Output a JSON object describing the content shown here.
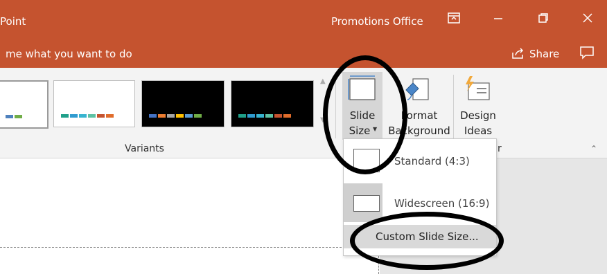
{
  "titlebar": {
    "app_fragment": "Point",
    "account": "Promotions Office",
    "icons": [
      "ribbon-display-icon",
      "minimize-icon",
      "restore-icon",
      "close-icon"
    ]
  },
  "tellbar": {
    "tell_me": "me what you want to do",
    "share": "Share"
  },
  "ribbon": {
    "variants_group_label": "Variants",
    "slide_size_line1": "Slide",
    "slide_size_line2": "Size",
    "format_background_line1": "Format",
    "format_background_line2": "Background",
    "design_ideas_line1": "Design",
    "design_ideas_line2": "Ideas",
    "designer_group_label_fragment": "r"
  },
  "dropdown": {
    "items": [
      {
        "label": "Standard (4:3)"
      },
      {
        "label": "Widescreen (16:9)"
      },
      {
        "label": "Custom Slide Size..."
      }
    ]
  },
  "colors": {
    "accent": "#c5532f",
    "ribbon": "#f3f3f3"
  }
}
